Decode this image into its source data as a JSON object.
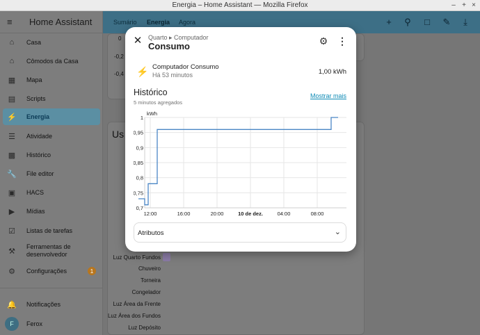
{
  "window": {
    "title": "Energia – Home Assistant — Mozilla Firefox",
    "controls": [
      "–",
      "+",
      "×"
    ]
  },
  "sidebar": {
    "menu_icon": "menu-icon",
    "app_title": "Home Assistant",
    "items": [
      {
        "label": "Casa",
        "icon": "home-icon"
      },
      {
        "label": "Cômodos da Casa",
        "icon": "home-icon"
      },
      {
        "label": "Mapa",
        "icon": "map-icon"
      },
      {
        "label": "Scripts",
        "icon": "script-icon"
      },
      {
        "label": "Energia",
        "icon": "lightning-icon",
        "active": true
      },
      {
        "label": "Atividade",
        "icon": "list-icon"
      },
      {
        "label": "Histórico",
        "icon": "chart-icon"
      },
      {
        "label": "File editor",
        "icon": "wrench-icon"
      },
      {
        "label": "HACS",
        "icon": "hacs-icon"
      },
      {
        "label": "Mídias",
        "icon": "media-icon"
      },
      {
        "label": "Listas de tarefas",
        "icon": "clipboard-icon"
      },
      {
        "label": "Ferramentas de desenvolvedor",
        "icon": "hammer-icon"
      },
      {
        "label": "Configurações",
        "icon": "gear-icon",
        "badge": "1"
      }
    ],
    "notifications": "Notificações",
    "user": {
      "name": "Ferox",
      "initial": "F"
    }
  },
  "appbar": {
    "tabs": [
      "Sumário",
      "Energia",
      "Agora"
    ],
    "active_tab": "Energia",
    "icons": [
      "plus-icon",
      "search-icon",
      "chat-icon",
      "pencil-icon",
      "download-icon"
    ]
  },
  "background": {
    "axis_labels": [
      "0",
      "-0,2",
      "-0,4"
    ],
    "card_heading": "Us",
    "devices": [
      "Luz Quarto Fundos",
      "Chuveiro",
      "Torneira",
      "Congelador",
      "Luz Área da Frente",
      "Luz Área dos Fundos",
      "Luz Depósito"
    ]
  },
  "dialog": {
    "breadcrumb": "Quarto ▸ Computador",
    "title": "Consumo",
    "entity": {
      "name": "Computador Consumo",
      "last_changed": "Há 53 minutos",
      "value": "1,00 kWh"
    },
    "history": {
      "title": "Histórico",
      "subtitle": "5 minutos agregados",
      "show_more": "Mostrar mais"
    },
    "attributes_label": "Atributos"
  },
  "colors": {
    "accent": "#3d6f86",
    "line": "#4a86c5",
    "link": "#0d8ab5",
    "badge": "#b8761e"
  },
  "chart_data": {
    "type": "line",
    "ylabel": "kWh",
    "ylim": [
      0.7,
      1.0
    ],
    "yticks": [
      "0,7",
      "0,75",
      "0,8",
      "0,85",
      "0,9",
      "0,95",
      "1"
    ],
    "xticks": [
      "12:00",
      "16:00",
      "20:00",
      "10 de dez.",
      "04:00",
      "08:00"
    ],
    "series": [
      {
        "points": [
          [
            "10:35",
            0.73
          ],
          [
            "11:20",
            0.73
          ],
          [
            "11:20",
            0.71
          ],
          [
            "11:45",
            0.71
          ],
          [
            "11:45",
            0.78
          ],
          [
            "12:50",
            0.78
          ],
          [
            "12:50",
            0.96
          ],
          [
            "09:40",
            0.96
          ],
          [
            "09:40",
            1.0
          ],
          [
            "10:30",
            1.0
          ]
        ]
      }
    ],
    "grid": true
  }
}
